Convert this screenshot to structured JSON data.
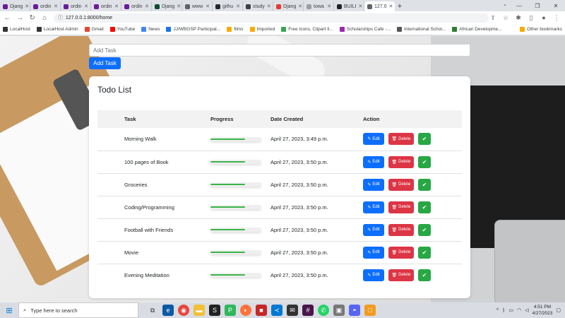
{
  "browser": {
    "tabs": [
      {
        "title": "Djang",
        "color": "#6a1b9a"
      },
      {
        "title": "ordin",
        "color": "#6a1b9a"
      },
      {
        "title": "ordin",
        "color": "#6a1b9a"
      },
      {
        "title": "ordin",
        "color": "#6a1b9a"
      },
      {
        "title": "ordin",
        "color": "#6a1b9a"
      },
      {
        "title": "Djang",
        "color": "#0c4b33"
      },
      {
        "title": "www",
        "color": "#5f6368"
      },
      {
        "title": "githu",
        "color": "#24292e"
      },
      {
        "title": "study",
        "color": "#3c4043"
      },
      {
        "title": "Djang",
        "color": "#e53935"
      },
      {
        "title": "towa",
        "color": "#9e9e9e"
      },
      {
        "title": "BUILI",
        "color": "#212121"
      },
      {
        "title": "127.0",
        "color": "#5f6368"
      }
    ],
    "new_tab": "+",
    "address": "127.0.0.1:8000/home",
    "bookmarks": [
      {
        "label": "LocalHost",
        "color": "#333333"
      },
      {
        "label": "LocalHost Admin",
        "color": "#333333"
      },
      {
        "label": "Gmail",
        "color": "#ea4335"
      },
      {
        "label": "YouTube",
        "color": "#ff0000"
      },
      {
        "label": "News",
        "color": "#4285f4"
      },
      {
        "label": "JJ/WBGSP Participat...",
        "color": "#1a73e8"
      },
      {
        "label": "films",
        "color": "#f9ab00"
      },
      {
        "label": "Imported",
        "color": "#f9ab00"
      },
      {
        "label": "Free Icons, Clipart Il...",
        "color": "#34a853"
      },
      {
        "label": "Scholarships Cafe -...",
        "color": "#9c27b0"
      },
      {
        "label": "International Schol...",
        "color": "#555555"
      },
      {
        "label": "African Developme...",
        "color": "#2e7d32"
      }
    ],
    "other_bookmarks": "Other bookmarks"
  },
  "app": {
    "add_placeholder": "Add Task",
    "add_button": "Add Task",
    "card_title": "Todo List",
    "columns": [
      "",
      "Task",
      "Progress",
      "Date Created",
      "Action"
    ],
    "edit_label": "Edit",
    "delete_label": "Delete",
    "progress_color": "#3bb54a",
    "tasks": [
      {
        "name": "Morning Walk",
        "progress": 0.68,
        "date": "April 27, 2023, 3:49 p.m."
      },
      {
        "name": "100 pages of Book",
        "progress": 0.68,
        "date": "April 27, 2023, 3:50 p.m."
      },
      {
        "name": "Groceries",
        "progress": 0.68,
        "date": "April 27, 2023, 3:50 p.m."
      },
      {
        "name": "Coding/Programming",
        "progress": 0.68,
        "date": "April 27, 2023, 3:50 p.m."
      },
      {
        "name": "Football with Friends",
        "progress": 0.68,
        "date": "April 27, 2023, 3:50 p.m."
      },
      {
        "name": "Movie",
        "progress": 0.68,
        "date": "April 27, 2023, 3:50 p.m."
      },
      {
        "name": "Evening Meditation",
        "progress": 0.68,
        "date": "April 27, 2023, 3:50 p.m."
      }
    ]
  },
  "taskbar": {
    "search_placeholder": "Type here to search",
    "time": "4:51 PM",
    "date": "4/27/2023"
  }
}
